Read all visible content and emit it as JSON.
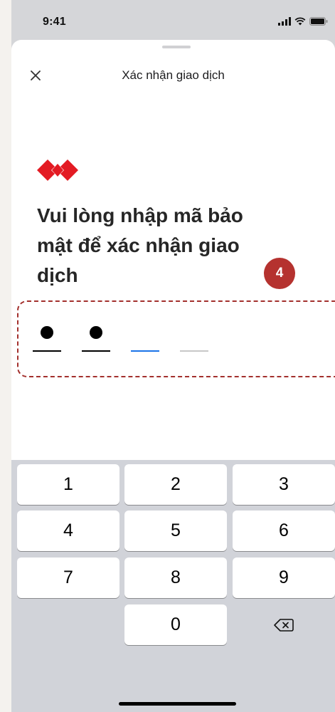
{
  "status_bar": {
    "time": "9:41"
  },
  "header": {
    "title": "Xác nhận giao dịch",
    "close_icon": "close-icon"
  },
  "brand": {
    "logo_icon": "diamond-logo-icon",
    "color": "#e31b23"
  },
  "main": {
    "heading": "Vui lòng nhập mã bảo mật để xác nhận giao dịch",
    "step_badge": "4",
    "pin": {
      "length": 4,
      "filled": 2,
      "active_index": 2,
      "active_color": "#1a73e8",
      "filled_color": "#000000",
      "empty_color": "#c8c8c8"
    },
    "highlight_color": "#a3302d"
  },
  "keypad": {
    "keys": [
      "1",
      "2",
      "3",
      "4",
      "5",
      "6",
      "7",
      "8",
      "9",
      "",
      "0",
      "⌫"
    ],
    "backspace_icon": "backspace-icon"
  }
}
